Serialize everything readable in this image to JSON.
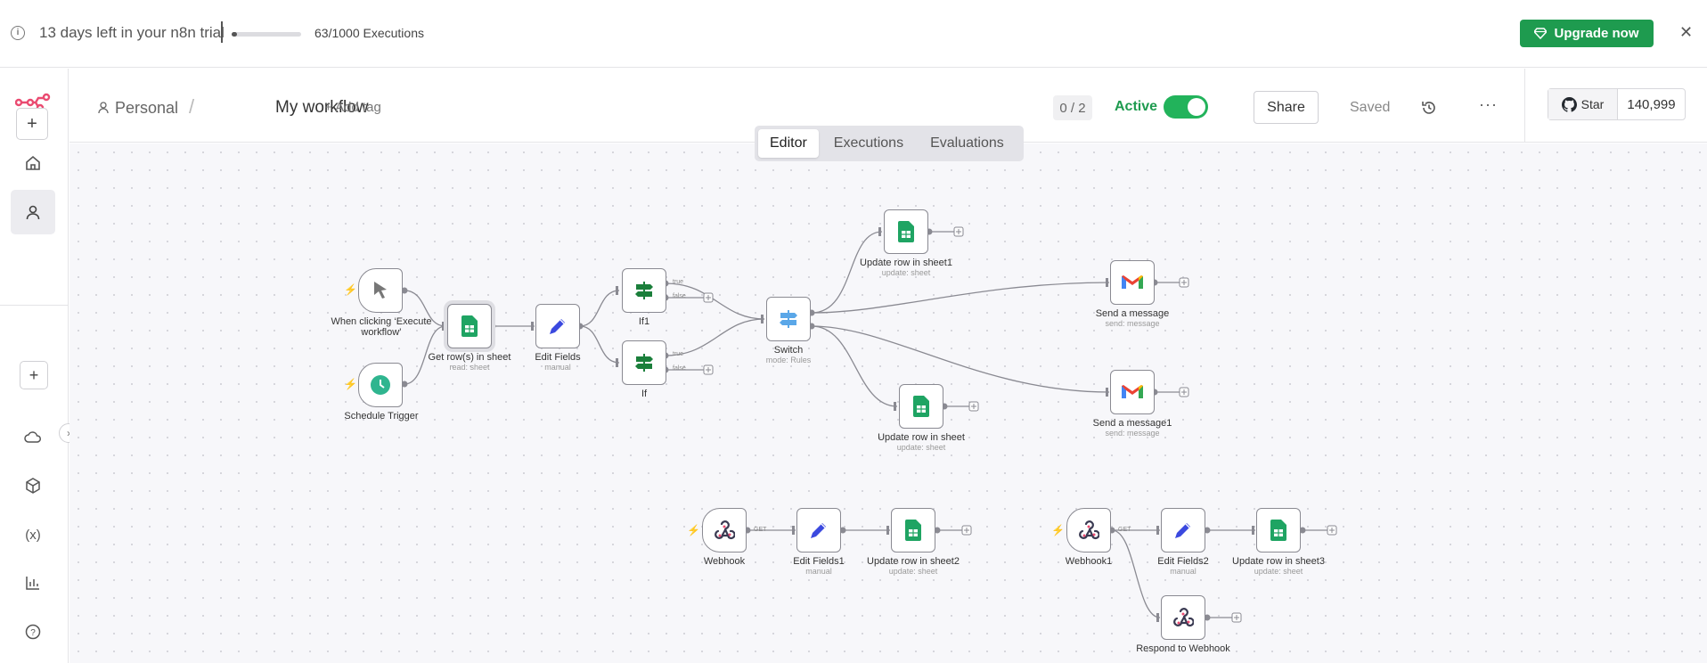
{
  "banner": {
    "trial_text": "13 days left in your n8n trial",
    "executions_text": "63/1000 Executions",
    "executions_fraction": 0.063,
    "upgrade_label": "Upgrade now",
    "info_icon": "info-icon",
    "close_icon": "close-icon"
  },
  "header": {
    "breadcrumb_project": "Personal",
    "breadcrumb_separator": "/",
    "workflow_name": "My workflow",
    "add_tag_label": "+ Add tag",
    "counter": "0 / 2",
    "active_label": "Active",
    "active": true,
    "share_label": "Share",
    "saved_label": "Saved",
    "more_label": "···",
    "github_star_label": "Star",
    "github_star_count": "140,999"
  },
  "tabs": [
    {
      "label": "Editor",
      "selected": true
    },
    {
      "label": "Executions",
      "selected": false
    },
    {
      "label": "Evaluations",
      "selected": false
    }
  ],
  "nodes": {
    "manual_trigger": {
      "label": "When clicking ‘Execute workflow’",
      "sub": ""
    },
    "schedule_trigger": {
      "label": "Schedule Trigger",
      "sub": ""
    },
    "get_rows": {
      "label": "Get row(s) in sheet",
      "sub": "read: sheet"
    },
    "edit_fields": {
      "label": "Edit Fields",
      "sub": "manual"
    },
    "if1": {
      "label": "If1",
      "sub": ""
    },
    "if": {
      "label": "If",
      "sub": ""
    },
    "switch": {
      "label": "Switch",
      "sub": "mode: Rules"
    },
    "update_row1": {
      "label": "Update row in sheet1",
      "sub": "update: sheet"
    },
    "update_row": {
      "label": "Update row in sheet",
      "sub": "update: sheet"
    },
    "send_message": {
      "label": "Send a message",
      "sub": "send: message"
    },
    "send_message1": {
      "label": "Send a message1",
      "sub": "send: message"
    },
    "webhook": {
      "label": "Webhook",
      "sub": ""
    },
    "edit_fields1": {
      "label": "Edit Fields1",
      "sub": "manual"
    },
    "update_row2": {
      "label": "Update row in sheet2",
      "sub": "update: sheet"
    },
    "webhook1": {
      "label": "Webhook1",
      "sub": ""
    },
    "edit_fields2": {
      "label": "Edit Fields2",
      "sub": "manual"
    },
    "update_row3": {
      "label": "Update row in sheet3",
      "sub": "update: sheet"
    },
    "respond_webhook": {
      "label": "Respond to Webhook",
      "sub": ""
    }
  },
  "port_labels": {
    "true": "true",
    "false": "false",
    "get": "GET"
  },
  "colors": {
    "accent_green": "#1e9b4f",
    "brand": "#ea4b71",
    "sheets_green": "#1fa463"
  }
}
